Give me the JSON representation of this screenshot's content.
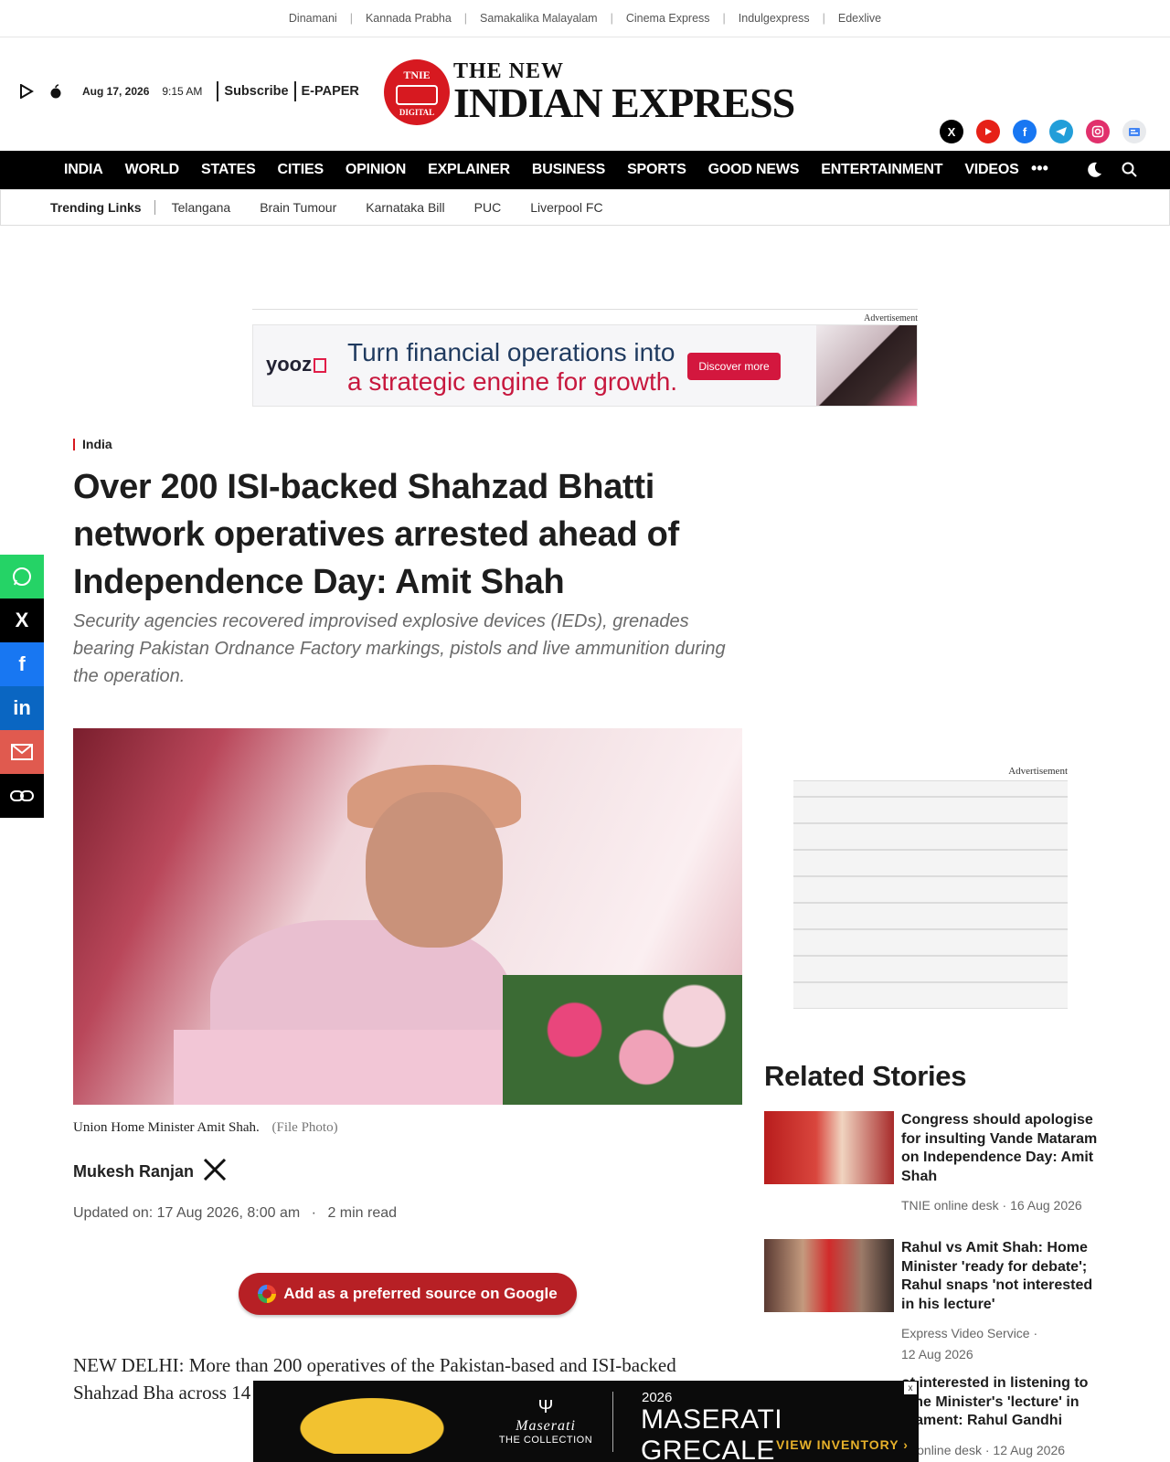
{
  "sister_sites": [
    "Dinamani",
    "Kannada Prabha",
    "Samakalika Malayalam",
    "Cinema Express",
    "Indulgexpress",
    "Edexlive"
  ],
  "header": {
    "date": "Aug 17, 2026",
    "time": "9:15 AM",
    "subscribe": "Subscribe",
    "epaper": "E-PAPER",
    "logo_line1": "THE NEW",
    "logo_line2": "INDIAN EXPRESS",
    "seal_top": "TNIE",
    "seal_bottom": "DIGITAL",
    "socials": [
      "x-icon",
      "youtube-icon",
      "facebook-icon",
      "telegram-icon",
      "instagram-icon",
      "google-news-icon"
    ]
  },
  "nav": {
    "items": [
      "INDIA",
      "WORLD",
      "STATES",
      "CITIES",
      "OPINION",
      "EXPLAINER",
      "BUSINESS",
      "SPORTS",
      "GOOD NEWS",
      "ENTERTAINMENT",
      "VIDEOS"
    ],
    "more": "•••"
  },
  "trending": {
    "label": "Trending Links",
    "links": [
      "Telangana",
      "Brain Tumour",
      "Karnataka Bill",
      "PUC",
      "Liverpool FC"
    ]
  },
  "ad_top": {
    "label": "Advertisement",
    "brand": "yooz",
    "line1": "Turn financial operations into",
    "line2": "a strategic engine for growth.",
    "cta": "Discover more"
  },
  "article": {
    "category": "India",
    "title": "Over 200 ISI-backed Shahzad Bhatti network operatives arrested ahead of Independence Day: Amit Shah",
    "summary": "Security agencies recovered improvised explosive devices (IEDs), grenades bearing Pakistan Ordnance Factory markings, pistols and live ammunition during the operation.",
    "caption": "Union Home Minister Amit Shah.",
    "caption_credit": "(File Photo)",
    "author": "Mukesh Ranjan",
    "updated": "Updated on: 17 Aug 2026, 8:00 am",
    "read_time": "2 min read",
    "google_button": "Add as a preferred source on Google",
    "body": "NEW DELHI: More than 200 operatives of the Pakistan-based and ISI-backed Shahzad Bha across 14 states ahea Shah said on Monda"
  },
  "share": [
    "whatsapp-icon",
    "x-icon",
    "facebook-icon",
    "linkedin-icon",
    "email-icon",
    "link-icon"
  ],
  "ad_right": {
    "label": "Advertisement"
  },
  "related": {
    "heading": "Related Stories",
    "items": [
      {
        "title": "Congress should apologise for insulting Vande Mataram on Independence Day: Amit Shah",
        "source": "TNIE online desk",
        "date": "16 Aug 2026"
      },
      {
        "title": "Rahul vs Amit Shah: Home Minister 'ready for debate'; Rahul snaps 'not interested in his lecture'",
        "source": "Express Video Service",
        "date": "12 Aug 2026"
      },
      {
        "title": "ot interested in listening to ome Minister's 'lecture' in rliament: Rahul Gandhi",
        "source": "IE online desk",
        "date": "12 Aug 2026"
      }
    ]
  },
  "ad_bottom": {
    "brand": "Maserati",
    "collection": "THE COLLECTION",
    "year": "2026",
    "model": "MASERATI GRECALE",
    "cta": "VIEW INVENTORY ›",
    "close": "x"
  },
  "colors": {
    "accent": "#d71920",
    "nav_bg": "#000000",
    "google_button": "#b72025"
  }
}
